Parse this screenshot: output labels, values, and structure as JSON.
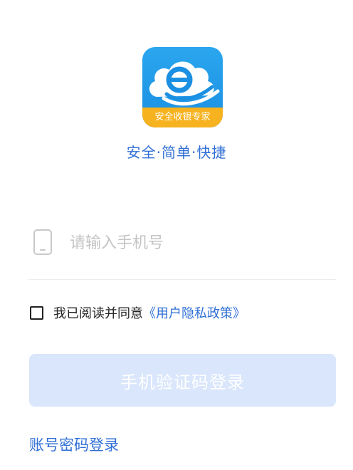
{
  "app": {
    "logo_ribbon_text": "安全收银专家",
    "tagline": "安全·简单·快捷",
    "logo_icon": "cloud-e-icon"
  },
  "phone": {
    "placeholder": "请输入手机号",
    "value": "",
    "icon": "phone-icon"
  },
  "agreement": {
    "checked": false,
    "text": "我已阅读并同意",
    "policy_link": "《用户隐私政策》"
  },
  "login_button": {
    "label": "手机验证码登录"
  },
  "password_login": {
    "label": "账号密码登录"
  },
  "colors": {
    "brand_blue": "#2f6fd6",
    "logo_blue": "#1b8fe2",
    "logo_ribbon": "#f6b21f",
    "button_disabled": "#d9e6fb"
  }
}
